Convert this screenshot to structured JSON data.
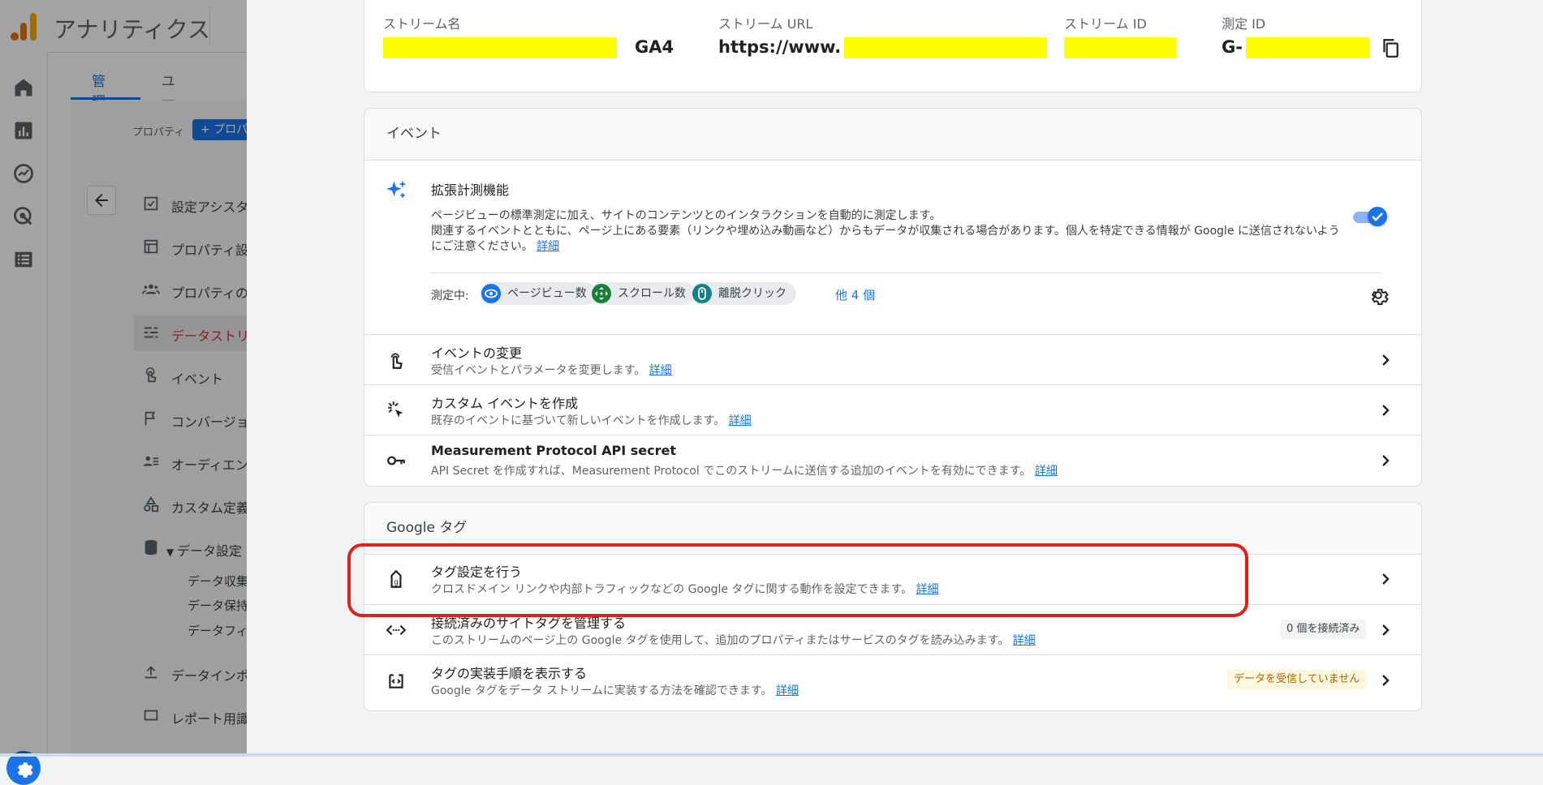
{
  "app": {
    "title": "アナリティクス",
    "tabs": [
      "管理",
      "ユーザー"
    ],
    "property_label": "プロパティ",
    "property_button": "+ プロパ",
    "admin_nav": [
      {
        "label": "設定アシスタント",
        "icon": "checklist-icon"
      },
      {
        "label": "プロパティ設定",
        "icon": "property-settings-icon"
      },
      {
        "label": "プロパティのアクセス管理",
        "icon": "people-icon"
      },
      {
        "label": "データストリーム",
        "icon": "data-stream-icon",
        "active": true
      },
      {
        "label": "イベント",
        "icon": "touch-icon"
      },
      {
        "label": "コンバージョン",
        "icon": "flag-icon"
      },
      {
        "label": "オーディエンス",
        "icon": "audience-icon"
      },
      {
        "label": "カスタム定義",
        "icon": "custom-definitions-icon"
      },
      {
        "label": "データ設定",
        "icon": "database-icon"
      }
    ],
    "data_settings_sub": [
      "データ収集",
      "データ保持",
      "データフィルタ"
    ],
    "admin_nav_tail": [
      "データインポート",
      "レポート用識別子"
    ]
  },
  "stream": {
    "name_label": "ストリーム名",
    "name_suffix": "GA4",
    "url_label": "ストリーム URL",
    "url_prefix": "https://www.",
    "id_label": "ストリーム ID",
    "measurement_label": "測定 ID",
    "measurement_prefix": "G-"
  },
  "events": {
    "header": "イベント",
    "enhanced": {
      "title": "拡張計測機能",
      "line1": "ページビューの標準測定に加え、サイトのコンテンツとのインタラクションを自動的に測定します。",
      "line2": "関連するイベントとともに、ページ上にある要素（リンクや埋め込み動画など）からもデータが収集される場合があります。個人を特定できる情報が Google に送信されないようにご注意ください。",
      "link": "詳細",
      "enabled": true,
      "measuring_label": "測定中:",
      "chips": [
        {
          "label": "ページビュー数",
          "color": "#1a73e8",
          "icon": "eye-icon"
        },
        {
          "label": "スクロール数",
          "color": "#188038",
          "icon": "scroll-icon"
        },
        {
          "label": "離脱クリック",
          "color": "#12828a",
          "icon": "mouse-icon"
        }
      ],
      "more": "他 4 個"
    },
    "rows": [
      {
        "title": "イベントの変更",
        "desc": "受信イベントとパラメータを変更します。",
        "link": "詳細",
        "icon": "touch-icon"
      },
      {
        "title": "カスタム イベントを作成",
        "desc": "既存のイベントに基づいて新しいイベントを作成します。",
        "link": "詳細",
        "icon": "sparkle-click-icon"
      },
      {
        "title": "Measurement Protocol API secret",
        "desc": "API Secret を作成すれば、Measurement Protocol でこのストリームに送信する追加のイベントを有効にできます。",
        "link": "詳細",
        "icon": "key-icon"
      }
    ]
  },
  "gtag": {
    "header": "Google タグ",
    "rows": [
      {
        "title": "タグ設定を行う",
        "desc": "クロスドメイン リンクや内部トラフィックなどの Google タグに関する動作を設定できます。",
        "link": "詳細",
        "icon": "tag-icon"
      },
      {
        "title": "接続済みのサイトタグを管理する",
        "desc": "このストリームのページ上の Google タグを使用して、追加のプロパティまたはサービスのタグを読み込みます。",
        "link": "詳細",
        "icon": "code-arrows-icon",
        "badge": "0 個を接続済み"
      },
      {
        "title": "タグの実装手順を表示する",
        "desc": "Google タグをデータ ストリームに実装する方法を確認できます。",
        "link": "詳細",
        "icon": "code-box-icon",
        "badge": "データを受信していません"
      }
    ]
  },
  "colors": {
    "accent": "#1a73e8",
    "highlight": "#e0211a",
    "warning_bg": "#fef7e0",
    "warning_text": "#b06000"
  }
}
